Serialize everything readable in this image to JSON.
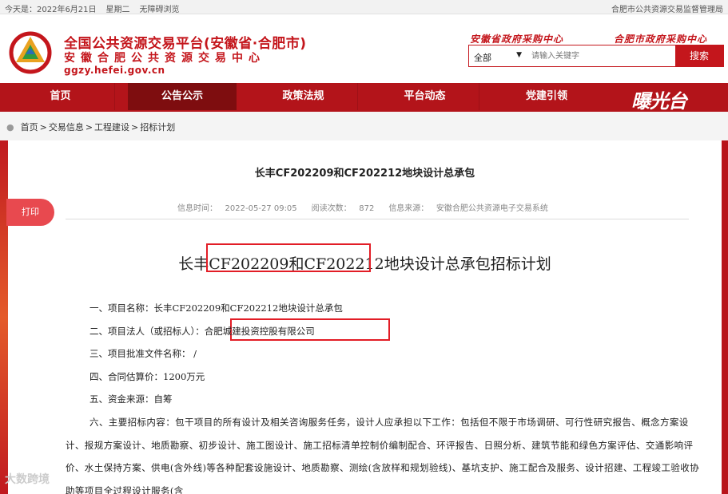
{
  "topbar": {
    "date": "今天是：2022年6月21日",
    "weekday": "星期二",
    "accessibility": "无障碍浏览",
    "right_link": "合肥市公共资源交易监督管理局"
  },
  "header": {
    "title": "全国公共资源交易平台(安徽省·合肥市)",
    "subtitle": "安徽合肥公共资源交易中心",
    "url": "ggzy.hefei.gov.cn",
    "link_province": "安徽省政府采购中心",
    "link_city": "合肥市政府采购中心"
  },
  "search": {
    "scope": "全部",
    "placeholder": "请输入关键字",
    "button": "搜索"
  },
  "nav": {
    "items": [
      "首页",
      "公告公示",
      "政策法规",
      "平台动态",
      "党建引领"
    ],
    "logo_text": "曝光台"
  },
  "breadcrumb": [
    "首页",
    "交易信息",
    "工程建设",
    "招标计划"
  ],
  "article": {
    "title": "长丰CF202209和CF202212地块设计总承包",
    "meta_time_label": "信息时间：",
    "meta_time": "2022-05-27 09:05",
    "meta_views_label": "阅读次数：",
    "meta_views": "872",
    "meta_source_label": "信息来源：",
    "meta_source": "安徽合肥公共资源电子交易系统",
    "print": "打印",
    "heading": "长丰CF202209和CF202212地块设计总承包招标计划",
    "lines": [
      "一、项目名称：长丰CF202209和CF202212地块设计总承包",
      "二、项目法人（或招标人）：合肥城建投资控股有限公司",
      "三、项目批准文件名称： /",
      "四、合同估算价：1200万元",
      "五、资金来源：自筹"
    ],
    "paragraph": "六、主要招标内容：包干项目的所有设计及相关咨询服务任务，设计人应承担以下工作：包括但不限于市场调研、可行性研究报告、概念方案设计、报规方案设计、地质勘察、初步设计、施工图设计、施工招标清单控制价编制配合、环评报告、日照分析、建筑节能和绿色方案评估、交通影响评价、水土保持方案、供电(含外线)等各种配套设施设计、地质勘察、测绘(含放样和规划验线)、基坑支护、施工配合及服务、设计招建、工程竣工验收协助等项目全过程设计服务(含"
  },
  "watermark": "大数跨境"
}
